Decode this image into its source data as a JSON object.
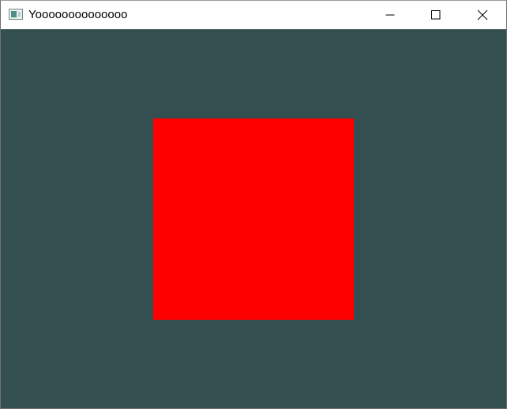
{
  "window": {
    "title": "Yoooooooooooooo",
    "app_icon": "application-window-icon",
    "controls": [
      {
        "name": "minimize",
        "icon": "minimize-icon"
      },
      {
        "name": "maximize",
        "icon": "maximize-icon"
      },
      {
        "name": "close",
        "icon": "close-icon"
      }
    ]
  },
  "canvas": {
    "background_color": "#344f4f",
    "shape": {
      "type": "square",
      "color": "#ff0000"
    }
  }
}
